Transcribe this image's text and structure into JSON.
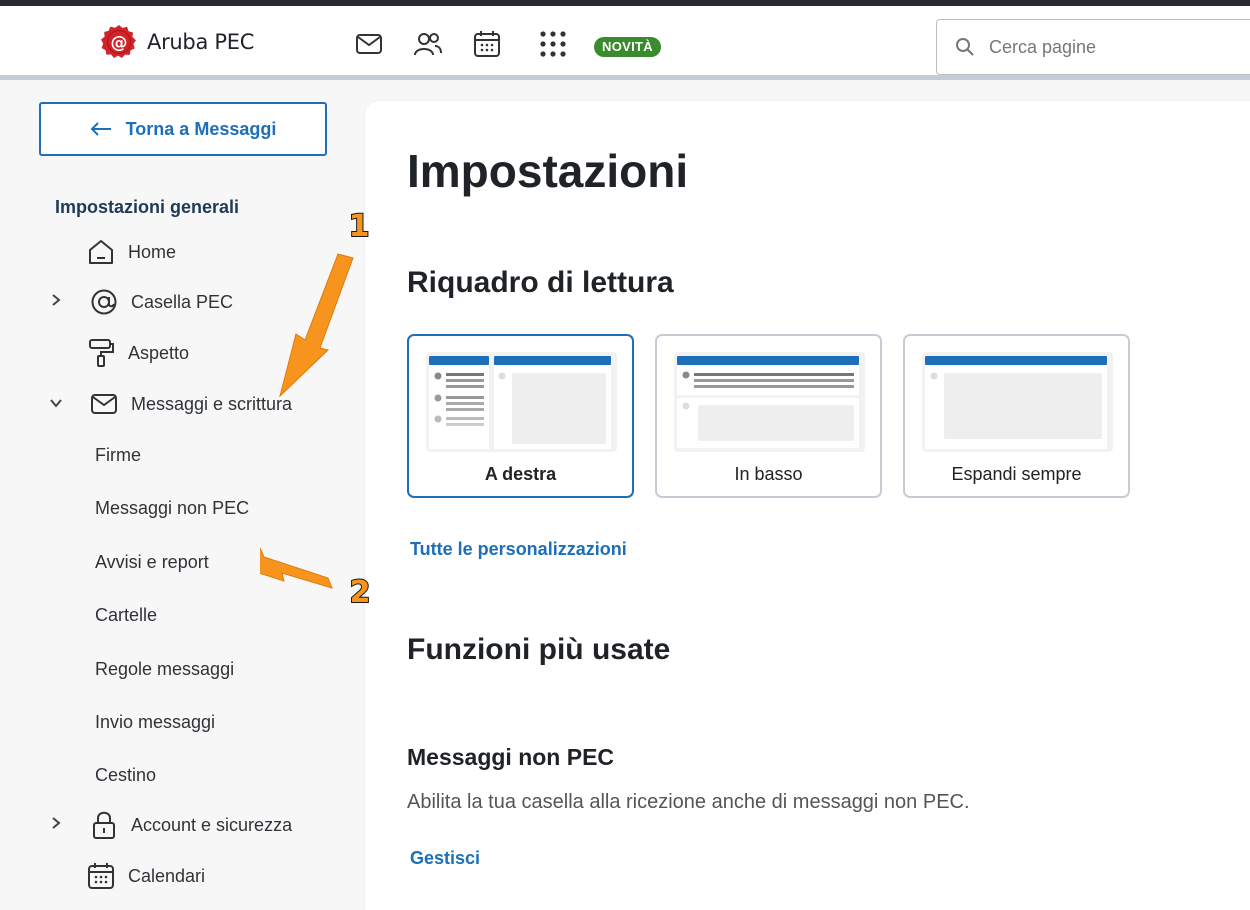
{
  "header": {
    "brand": "Aruba PEC",
    "nav_icons": [
      "mail-icon",
      "contacts-icon",
      "calendar-icon",
      "apps-grid-icon"
    ],
    "badge": "NOVITÀ",
    "search_placeholder": "Cerca pagine"
  },
  "sidebar": {
    "back_label": "Torna a Messaggi",
    "section_title": "Impostazioni generali",
    "items": [
      {
        "label": "Home",
        "icon": "home-icon",
        "chevron": ""
      },
      {
        "label": "Casella PEC",
        "icon": "at-icon",
        "chevron": "collapsed"
      },
      {
        "label": "Aspetto",
        "icon": "paint-roller-icon",
        "chevron": ""
      },
      {
        "label": "Messaggi e scrittura",
        "icon": "envelope-icon",
        "chevron": "expanded"
      },
      {
        "label": "Account e sicurezza",
        "icon": "lock-icon",
        "chevron": "collapsed"
      },
      {
        "label": "Calendari",
        "icon": "calendar-icon",
        "chevron": ""
      }
    ],
    "subitems": [
      "Firme",
      "Messaggi non PEC",
      "Avvisi e report",
      "Cartelle",
      "Regole messaggi",
      "Invio messaggi",
      "Cestino"
    ]
  },
  "main": {
    "title": "Impostazioni",
    "reading_pane": {
      "heading": "Riquadro di lettura",
      "options": [
        {
          "label": "A destra",
          "selected": true
        },
        {
          "label": "In basso",
          "selected": false
        },
        {
          "label": "Espandi sempre",
          "selected": false
        }
      ],
      "link": "Tutte le personalizzazioni"
    },
    "most_used": {
      "heading": "Funzioni più usate",
      "item_title": "Messaggi non PEC",
      "item_desc": "Abilita la tua casella alla ricezione anche di messaggi non PEC.",
      "item_link": "Gestisci"
    }
  },
  "annotations": [
    "1",
    "2"
  ],
  "colors": {
    "accent": "#1c6fb8",
    "badge": "#3a8a2e",
    "annotation": "#f7941d",
    "brand_red": "#d1242a"
  }
}
